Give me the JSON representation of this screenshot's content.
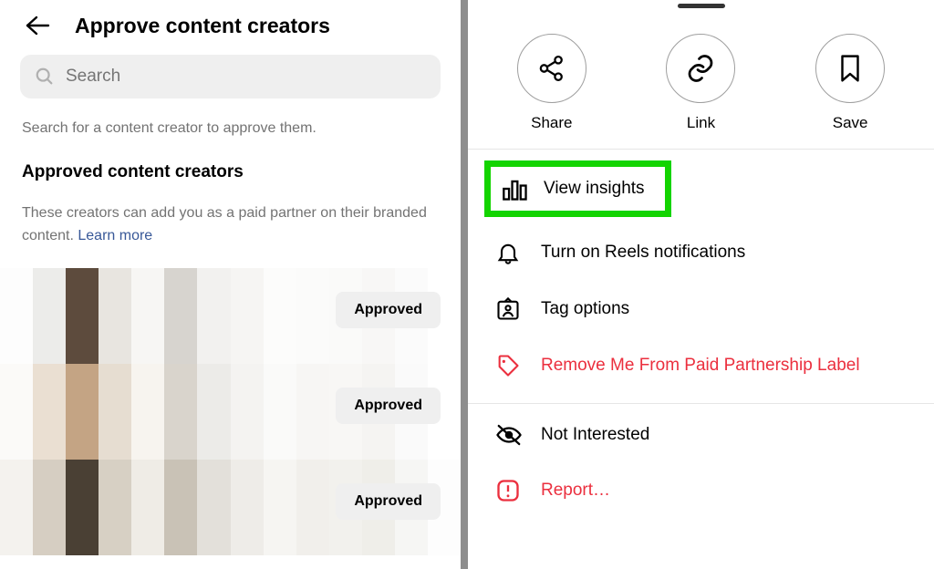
{
  "left": {
    "title": "Approve content creators",
    "search_placeholder": "Search",
    "hint": "Search for a content creator to approve them.",
    "subheading": "Approved content creators",
    "description": "These creators can add you as a paid partner on their branded content. ",
    "learn_more": "Learn more",
    "approved_label": "Approved",
    "rows": 3
  },
  "right": {
    "actions": {
      "share": "Share",
      "link": "Link",
      "save": "Save"
    },
    "menu": {
      "insights": "View insights",
      "reels_notif": "Turn on Reels notifications",
      "tag_options": "Tag options",
      "remove_partnership": "Remove Me From Paid Partnership Label",
      "not_interested": "Not Interested",
      "report": "Report…"
    }
  },
  "colors": {
    "highlight_green": "#13d400",
    "danger": "#eb2f3e"
  }
}
